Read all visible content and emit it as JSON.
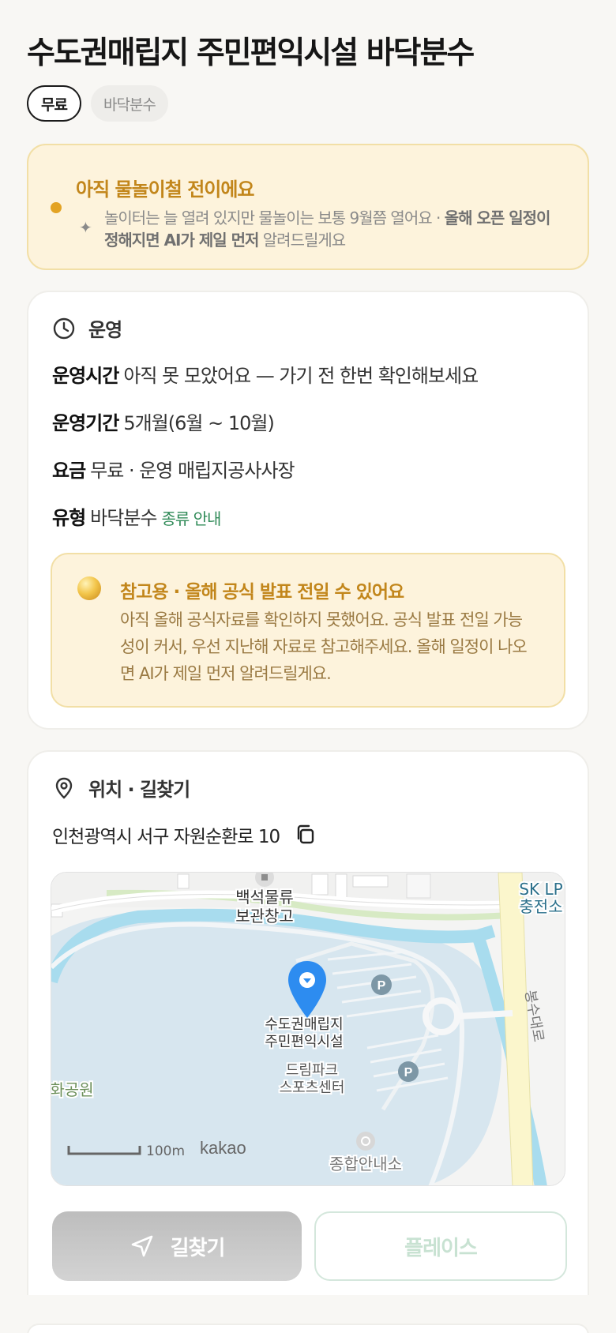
{
  "header": {
    "title": "수도권매립지 주민편익시설 바닥분수",
    "chips": [
      "무료",
      "바닥분수"
    ]
  },
  "notice": {
    "title": "아직 물놀이철 전이에요",
    "text_plain": "놀이터는 늘 열려 있지만 물놀이는 보통 9월쯤 열어요 · ",
    "text_bold": "올해 오픈 일정이 정해지면 AI가 제일 먼저",
    "text_tail": " 알려드릴게요",
    "colors": {
      "accent": "#c2861b",
      "dot": "#e3a324",
      "background": "#fdf3dc"
    }
  },
  "operation": {
    "heading": "운영",
    "rows": [
      {
        "key": "운영시간",
        "value": "아직 못 모았어요 — 가기 전 한번 확인해보세요"
      },
      {
        "key": "운영기간",
        "value": "5개월(6월 ~ 10월)"
      },
      {
        "key": "요금",
        "value": "무료 · 운영 매립지공사사장"
      },
      {
        "key": "유형",
        "value": "바닥분수",
        "link": "종류 안내"
      }
    ],
    "reference": {
      "title": "참고용 · 올해 공식 발표 전일 수 있어요",
      "text": "아직 올해 공식자료를 확인하지 못했어요. 공식 발표 전일 가능성이 커서, 우선 지난해 자료로 참고해주세요. 올해 일정이 나오면 AI가 제일 먼저 알려드릴게요."
    }
  },
  "location": {
    "heading": "위치 · 길찾기",
    "address": "인천광역시 서구 자원순환로 10",
    "map": {
      "labels": {
        "warehouse_1": "백석물류",
        "warehouse_2": "보관창고",
        "sk_1": "SK LP",
        "sk_2": "충전소",
        "road": "봉수대로",
        "place_1": "수도권매립지",
        "place_2": "주민편익시설",
        "dream_1": "드림파크",
        "dream_2": "스포츠센터",
        "park": "화공원",
        "info": "종합안내소",
        "scale": "100m",
        "brand": "kakao",
        "parking": "P"
      },
      "colors": {
        "water": "#a8dcee",
        "land": "#d7e6ef",
        "road": "#fbf6cc",
        "marker": "#2d8cf0"
      }
    },
    "buttons": {
      "route": "길찾기",
      "place": "플레이스"
    }
  }
}
